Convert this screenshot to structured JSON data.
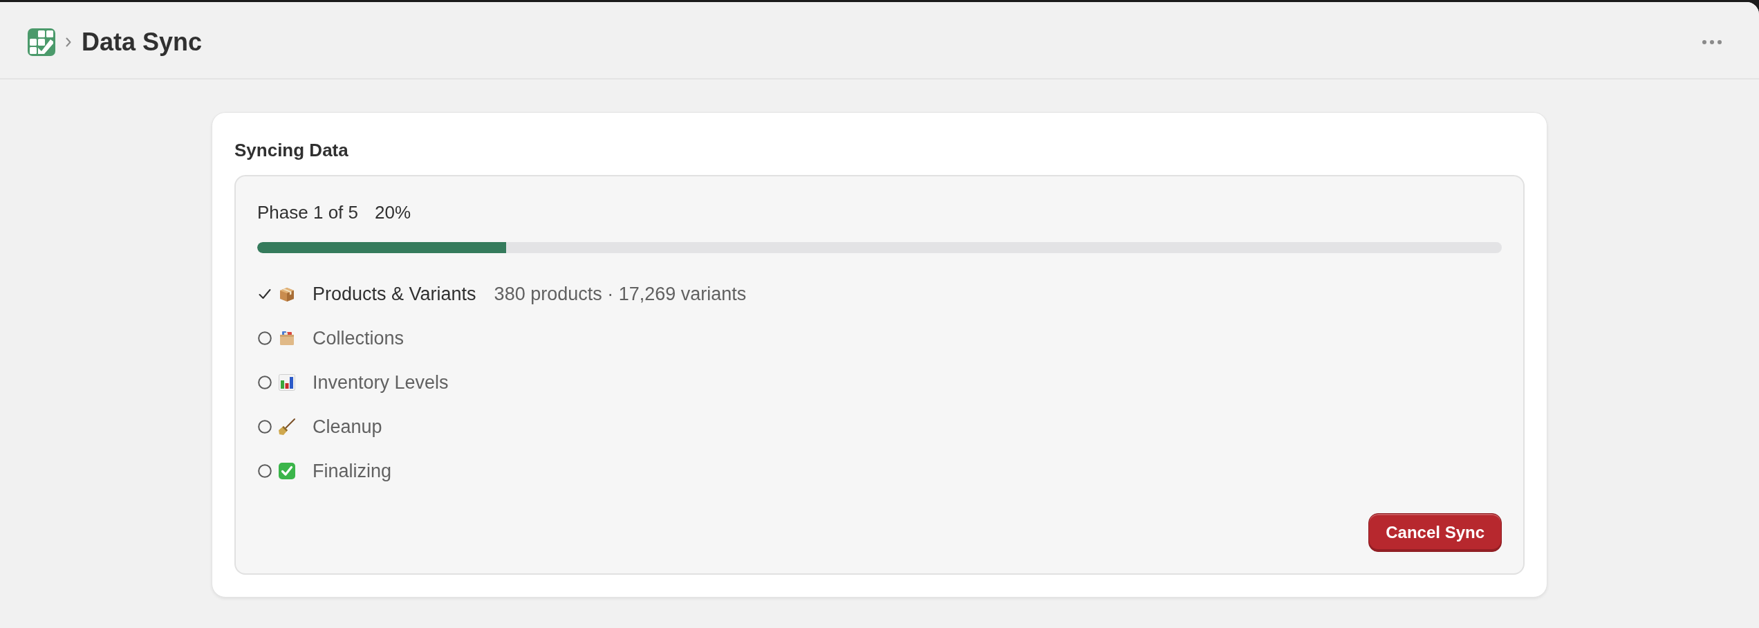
{
  "header": {
    "title": "Data Sync"
  },
  "card": {
    "title": "Syncing Data",
    "phase": "Phase 1 of 5",
    "percent": "20%",
    "progress": {
      "level": 0.2
    },
    "steps": [
      {
        "kind": "package",
        "label": "Products & Variants",
        "detail": "380 products · 17,269 variants",
        "done": true
      },
      {
        "kind": "cardbox",
        "label": "Collections",
        "done": false
      },
      {
        "kind": "chart",
        "label": "Inventory Levels",
        "done": false
      },
      {
        "kind": "broom",
        "label": "Cleanup",
        "done": false
      },
      {
        "kind": "checkbox",
        "label": "Finalizing",
        "done": false
      }
    ],
    "cancel_button": {
      "label": "Cancel Sync"
    }
  }
}
